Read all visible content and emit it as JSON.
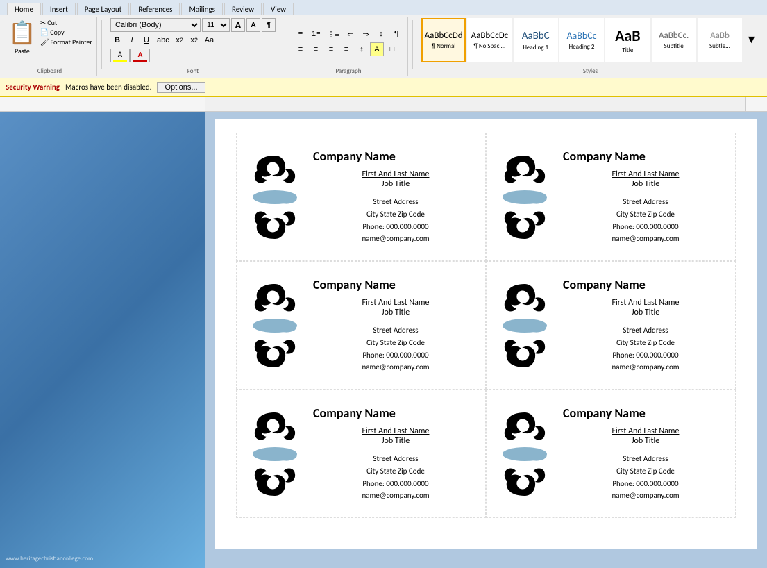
{
  "ribbon": {
    "tabs": [
      "Home",
      "Insert",
      "Page Layout",
      "References",
      "Mailings",
      "Review",
      "View"
    ],
    "active_tab": "Home",
    "font": {
      "name": "Calibri (Body)",
      "size": "11",
      "bold": "B",
      "italic": "I",
      "underline": "U",
      "strikethrough": "abc",
      "subscript": "x₂",
      "superscript": "x²",
      "case": "Aa"
    },
    "clipboard": {
      "paste": "Paste",
      "cut": "Cut",
      "copy": "Copy",
      "format_painter": "Format Painter",
      "label": "Clipboard"
    },
    "font_label": "Font",
    "paragraph_label": "Paragraph",
    "styles_label": "Styles",
    "styles": [
      {
        "id": "normal",
        "label": "¶ Normal",
        "active": true
      },
      {
        "id": "no_spacing",
        "label": "¶ No Spaci..."
      },
      {
        "id": "heading1",
        "label": "Heading 1"
      },
      {
        "id": "heading2",
        "label": "Heading 2"
      },
      {
        "id": "title",
        "label": "Title"
      },
      {
        "id": "subtitle",
        "label": "Subtitle"
      },
      {
        "id": "subtle",
        "label": "AaBb"
      }
    ]
  },
  "security": {
    "label": "Security Warning",
    "message": "Macros have been disabled.",
    "options_btn": "Options..."
  },
  "card": {
    "company_name": "Company Name",
    "first_last": "First And Last Name",
    "job_title": "Job Title",
    "street": "Street Address",
    "city_state": "City State Zip Code",
    "phone": "Phone: 000.000.0000",
    "email": "name@company.com"
  },
  "footer": {
    "url": "www.heritagechristiancollege.com"
  }
}
